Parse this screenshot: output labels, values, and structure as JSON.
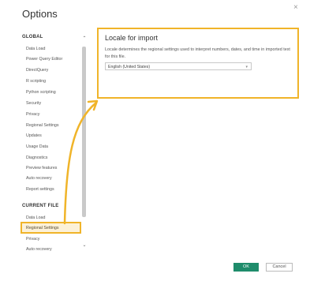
{
  "dialog": {
    "title": "Options",
    "close_icon": "×"
  },
  "sidebar": {
    "global_header": "GLOBAL",
    "global_items": [
      "Data Load",
      "Power Query Editor",
      "DirectQuery",
      "R scripting",
      "Python scripting",
      "Security",
      "Privacy",
      "Regional Settings",
      "Updates",
      "Usage Data",
      "Diagnostics",
      "Preview features",
      "Auto recovery",
      "Report settings"
    ],
    "current_header": "CURRENT FILE",
    "current_items": [
      "Data Load",
      "Regional Settings",
      "Privacy",
      "Auto recovery"
    ]
  },
  "scroll": {
    "up_icon": "⌃",
    "down_icon": "⌄"
  },
  "panel": {
    "title": "Locale for import",
    "description": "Locale determines the regional settings used to interpret numbers, dates, and time in imported text for this file.",
    "selected_locale": "English (United States)",
    "dropdown_icon": "▾"
  },
  "footer": {
    "ok_label": "OK",
    "cancel_label": "Cancel"
  },
  "colors": {
    "highlight": "#f0b429",
    "ok": "#1f8c6b"
  }
}
